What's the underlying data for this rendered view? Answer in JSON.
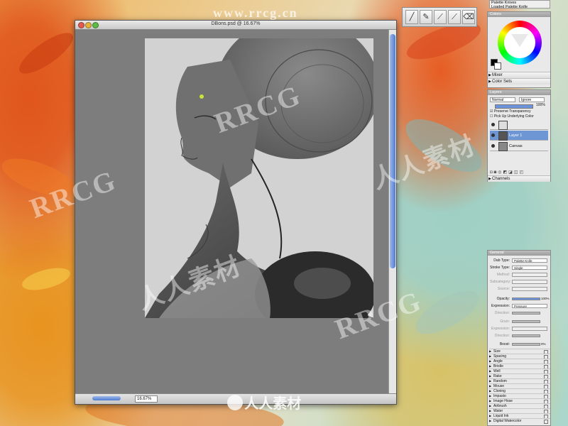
{
  "document": {
    "title": "DBons.psd @ 16.67%",
    "zoom": "16.67%"
  },
  "tool_label": {
    "line1": "Palette Knives",
    "line2": "Loaded Palette Knife"
  },
  "panels": {
    "colors": {
      "title": "Colors",
      "rows": [
        "Mixer",
        "Color Sets"
      ]
    },
    "layers": {
      "title": "Layers",
      "composite_method": "Normal",
      "ignore": "Ignore",
      "opacity": "100%",
      "checkboxes": [
        "Preserve Transparency",
        "Pick Up Underlying Color"
      ],
      "items": [
        {
          "name": "",
          "selected": false
        },
        {
          "name": "Layer 1",
          "selected": true
        },
        {
          "name": "Canvas",
          "selected": false
        }
      ],
      "channels": "Channels"
    },
    "general": {
      "title": "General",
      "dab_type_label": "Dab Type:",
      "dab_type": "Palette Knife",
      "stroke_type_label": "Stroke Type:",
      "stroke_type": "Single",
      "method_label": "Method:",
      "subcategory_label": "Subcategory:",
      "source_label": "Source:",
      "opacity_label": "Opacity:",
      "opacity_value": "100%",
      "expression_label": "Expression:",
      "expression_value": "Pressure",
      "direction_label": "Direction:",
      "grain_label": "Grain:",
      "expression2_label": "Expression:",
      "direction2_label": "Direction:",
      "boost_label": "Boost:",
      "boost_value": "0%"
    },
    "categories": [
      "Size",
      "Spacing",
      "Angle",
      "Bristle",
      "Well",
      "Rake",
      "Random",
      "Mouse",
      "Cloning",
      "Impasto",
      "Image Hose",
      "Airbrush",
      "Water",
      "Liquid Ink",
      "Digital Watercolor"
    ]
  },
  "watermark": {
    "brand": "RRCG",
    "domain": "www.rrcg.cn",
    "cn_text": "人人素材"
  },
  "colors": {
    "accent": "#4f7bd0",
    "primary_color": "#000000",
    "secondary_color": "#ffffff"
  }
}
